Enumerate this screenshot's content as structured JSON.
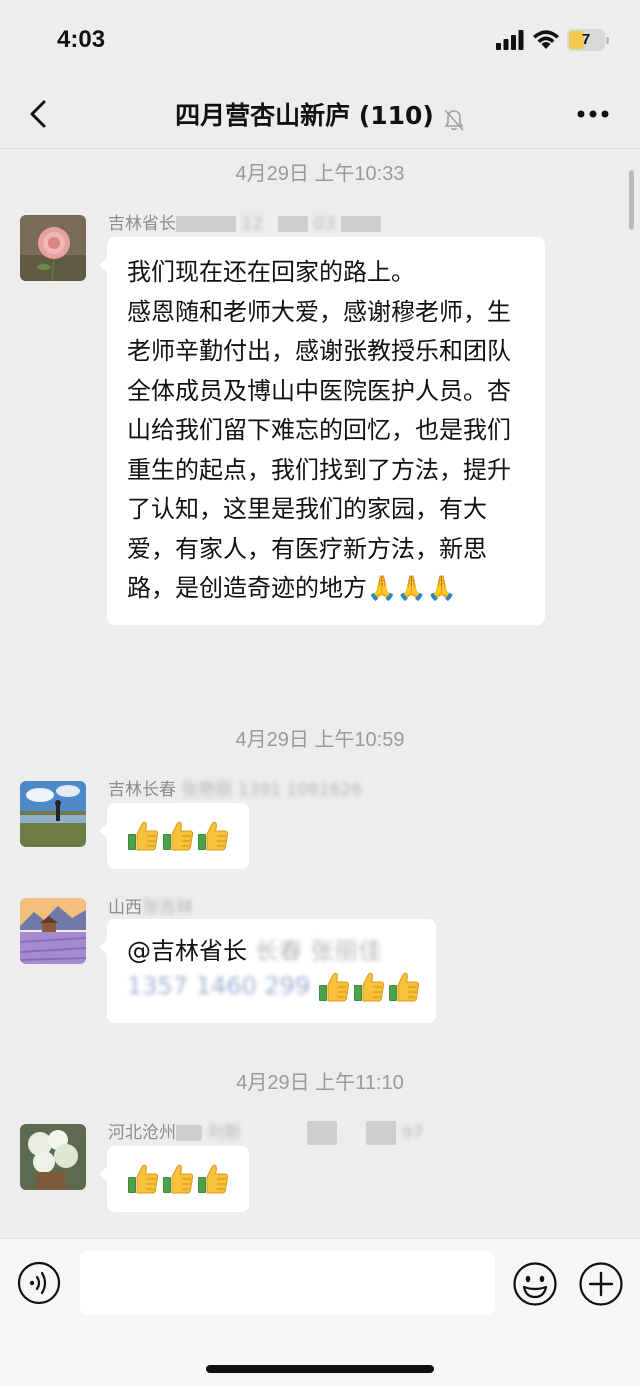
{
  "status_bar": {
    "time": "4:03",
    "battery": "7"
  },
  "header": {
    "title": "四月营杏山新庐 (110)"
  },
  "messages": [
    {
      "timestamp": "4月29日 上午10:33",
      "sender": "吉林省长",
      "text": "我们现在还在回家的路上。\n感恩随和老师大爱，感谢穆老师，生老师辛勤付出，感谢张教授乐和团队全体成员及博山中医院医护人员。杏山给我们留下难忘的回忆，也是我们重生的起点，我们找到了方法，提升了认知，这里是我们的家园，有大爱，有家人，有医疗新方法，新思路，是创造奇迹的地方🙏🙏🙏"
    },
    {
      "timestamp": "4月29日 上午10:59",
      "sender": "吉林长春",
      "text": "👍👍👍"
    },
    {
      "sender": "山西",
      "text_line1": "@吉林省长",
      "text_line2": "👍👍👍"
    },
    {
      "timestamp": "4月29日 上午11:10",
      "sender": "河北沧州",
      "text": "👍👍👍"
    }
  ],
  "input": {
    "placeholder": ""
  },
  "colors": {
    "background": "#ededed",
    "bubble": "#ffffff",
    "timestamp": "#9a9a9a"
  }
}
